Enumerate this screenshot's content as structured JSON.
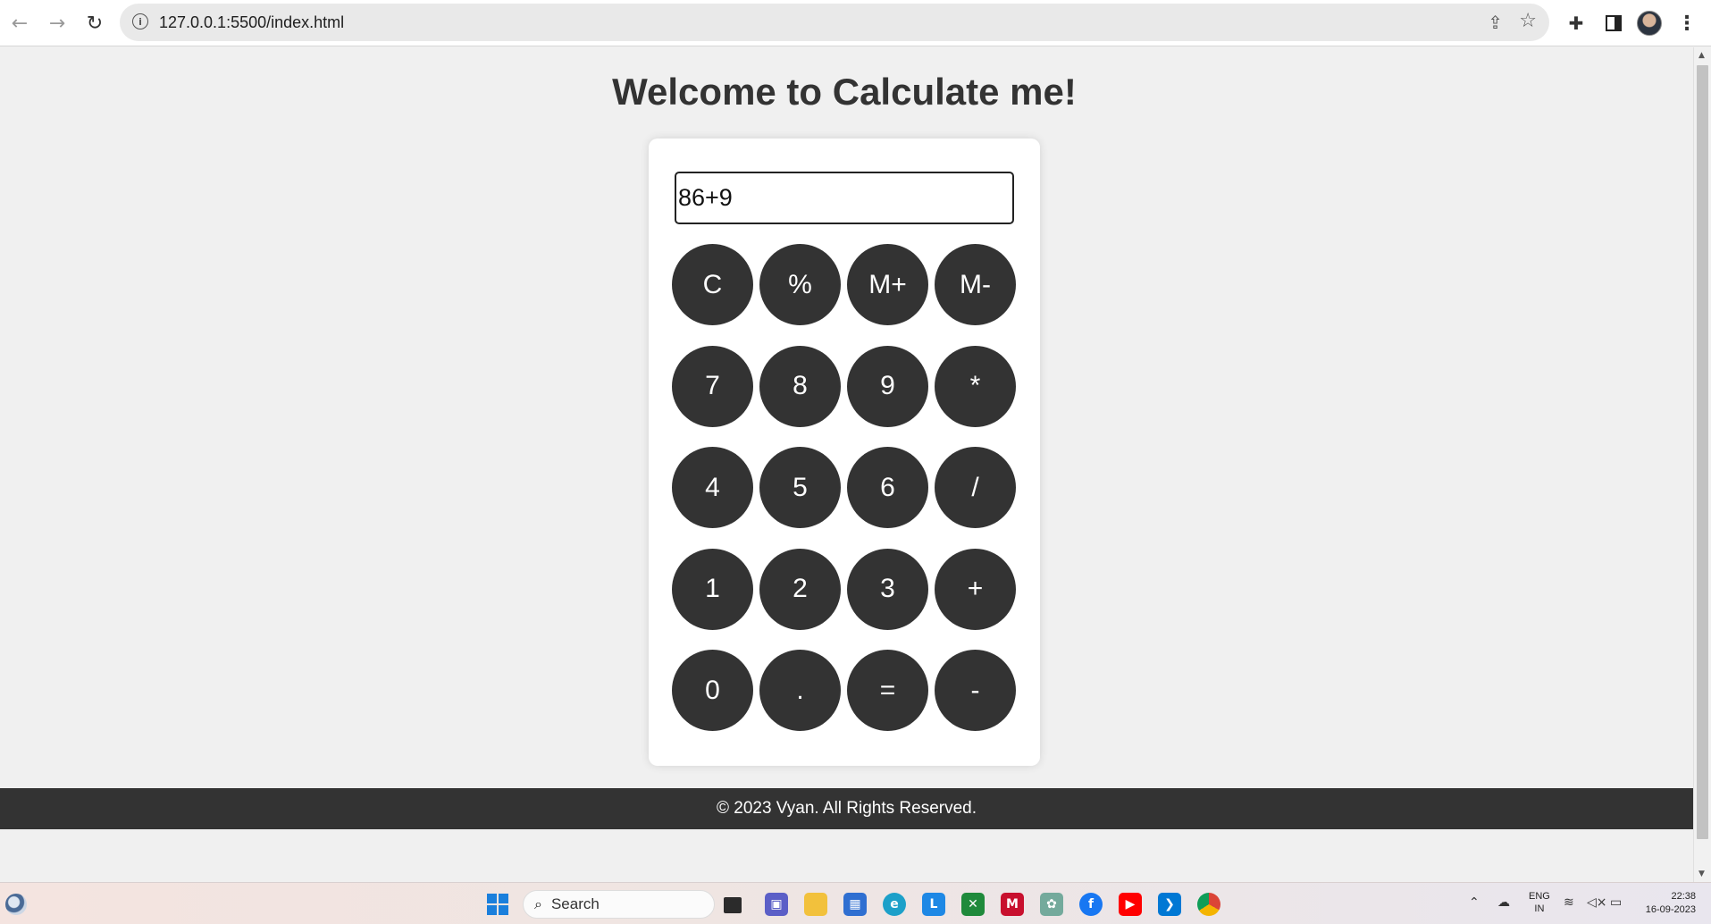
{
  "browser": {
    "url": "127.0.0.1:5500/index.html",
    "back_icon": "back-arrow-icon",
    "forward_icon": "forward-arrow-icon",
    "reload_icon": "reload-icon"
  },
  "page": {
    "title": "Welcome to Calculate me!",
    "display_value": "86+9",
    "keys": [
      [
        "C",
        "%",
        "M+",
        "M-"
      ],
      [
        "7",
        "8",
        "9",
        "*"
      ],
      [
        "4",
        "5",
        "6",
        "/"
      ],
      [
        "1",
        "2",
        "3",
        "+"
      ],
      [
        "0",
        ".",
        "=",
        "-"
      ]
    ],
    "footer": "© 2023 Vyan. All Rights Reserved."
  },
  "taskbar": {
    "search_label": "Search",
    "lang_top": "ENG",
    "lang_bottom": "IN",
    "time": "22:38",
    "date": "16-09-2023"
  },
  "colors": {
    "key_bg": "#333333",
    "page_bg": "#f0f0f0",
    "footer_bg": "#333333"
  }
}
